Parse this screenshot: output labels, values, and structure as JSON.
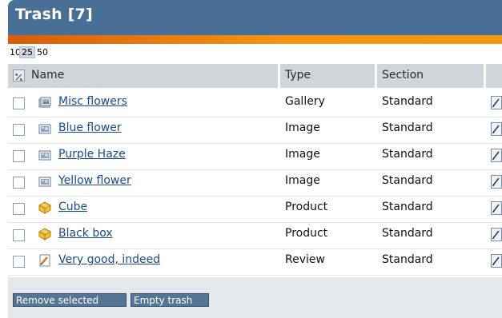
{
  "header": {
    "title": "Trash [7]"
  },
  "pager": {
    "options": [
      "10",
      "25",
      "50"
    ],
    "selected": "25"
  },
  "table": {
    "columns": {
      "name": "Name",
      "type": "Type",
      "section": "Section",
      "actions": ""
    },
    "rows": [
      {
        "name": "Misc flowers",
        "type": "Gallery",
        "section": "Standard",
        "icon": "gallery-icon"
      },
      {
        "name": "Blue flower",
        "type": "Image",
        "section": "Standard",
        "icon": "image-icon"
      },
      {
        "name": "Purple Haze",
        "type": "Image",
        "section": "Standard",
        "icon": "image-icon"
      },
      {
        "name": "Yellow flower",
        "type": "Image",
        "section": "Standard",
        "icon": "image-icon"
      },
      {
        "name": "Cube",
        "type": "Product",
        "section": "Standard",
        "icon": "product-icon"
      },
      {
        "name": "Black box",
        "type": "Product",
        "section": "Standard",
        "icon": "product-icon"
      },
      {
        "name": "Very good, indeed",
        "type": "Review",
        "section": "Standard",
        "icon": "review-icon"
      }
    ]
  },
  "footer": {
    "remove_label": "Remove selected",
    "empty_label": "Empty trash"
  },
  "colors": {
    "header": "#4a6f97",
    "accent": "#f39413",
    "link": "#1a4a8f",
    "button": "#557597"
  }
}
